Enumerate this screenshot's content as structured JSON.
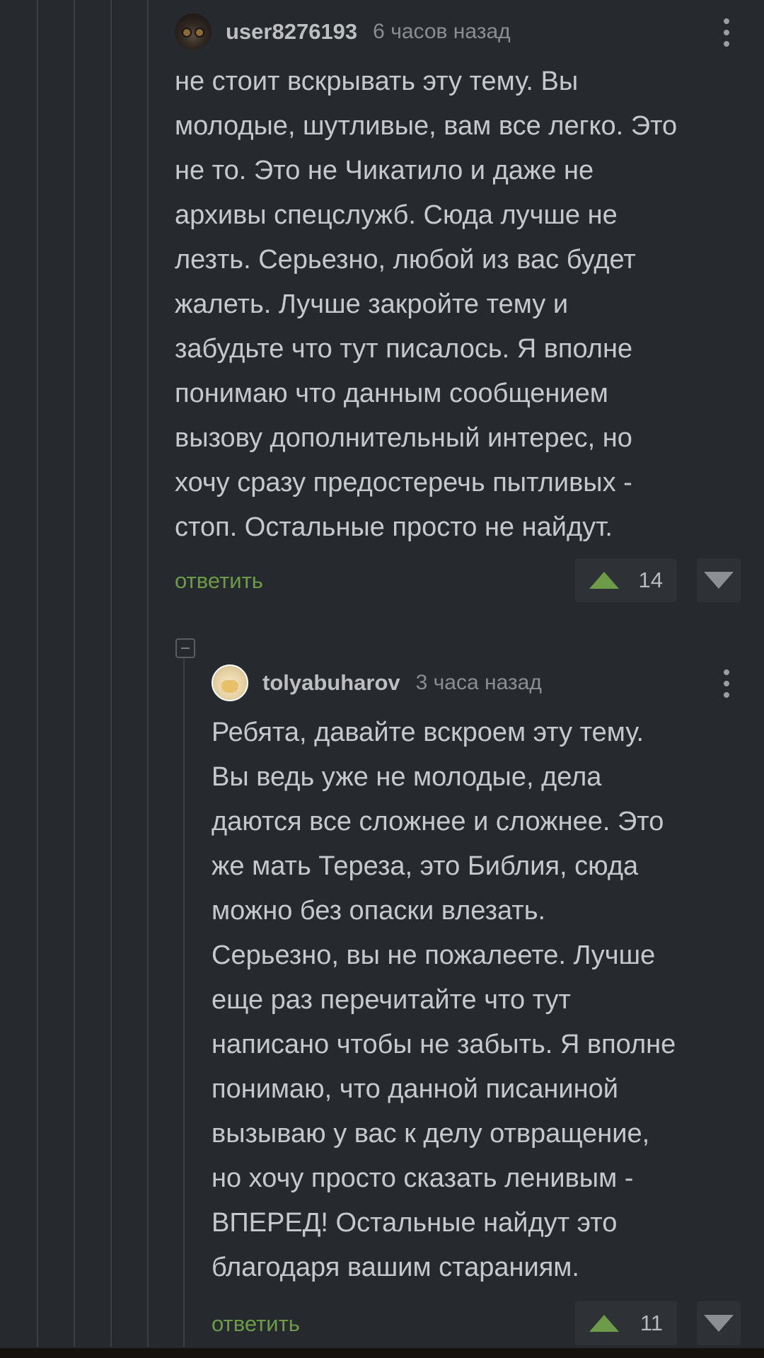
{
  "comments": [
    {
      "username": "user8276193",
      "timestamp": "6 часов назад",
      "text": "не стоит вскрывать эту тему. Вы\nмолодые, шутливые, вам все легко. Это\nне то. Это не Чикатило и даже не\nархивы спецслужб. Сюда лучше не\nлезть. Серьезно, любой из вас будет\nжалеть. Лучше закройте тему и\nзабудьте что тут писалось. Я вполне\nпонимаю что данным сообщением\nвызову дополнительный интерес, но\nхочу сразу предостеречь пытливых -\nстоп. Остальные просто не найдут.",
      "reply_label": "ответить",
      "rating": "14"
    },
    {
      "username": "tolyabuharov",
      "timestamp": "3 часа назад",
      "text": "Ребята, давайте вскроем эту тему.\nВы ведь уже не молодые, дела\nдаются все сложнее и сложнее. Это\nже мать Тереза, это Библия, сюда\nможно без опаски влезать.\nСерьезно, вы не пожалеете. Лучше\nеще раз перечитайте что тут\nнаписано чтобы не забыть. Я вполне\nпонимаю, что данной писаниной\nвызываю у вас к делу отвращение,\nно хочу просто сказать ленивым -\nВПЕРЕД! Остальные найдут это\nблагодаря вашим стараниям.",
      "reply_label": "ответить",
      "rating": "11"
    }
  ],
  "colors": {
    "background": "#26292d",
    "reply_link": "#6d9b4a",
    "upvote": "#6d9b4a",
    "downvote": "#8c9095",
    "thread_line": "#3b3f44"
  },
  "icons": {
    "more": "more-vertical-icon",
    "upvote": "upvote-arrow-icon",
    "downvote": "downvote-arrow-icon",
    "collapse": "collapse-minus-icon"
  }
}
